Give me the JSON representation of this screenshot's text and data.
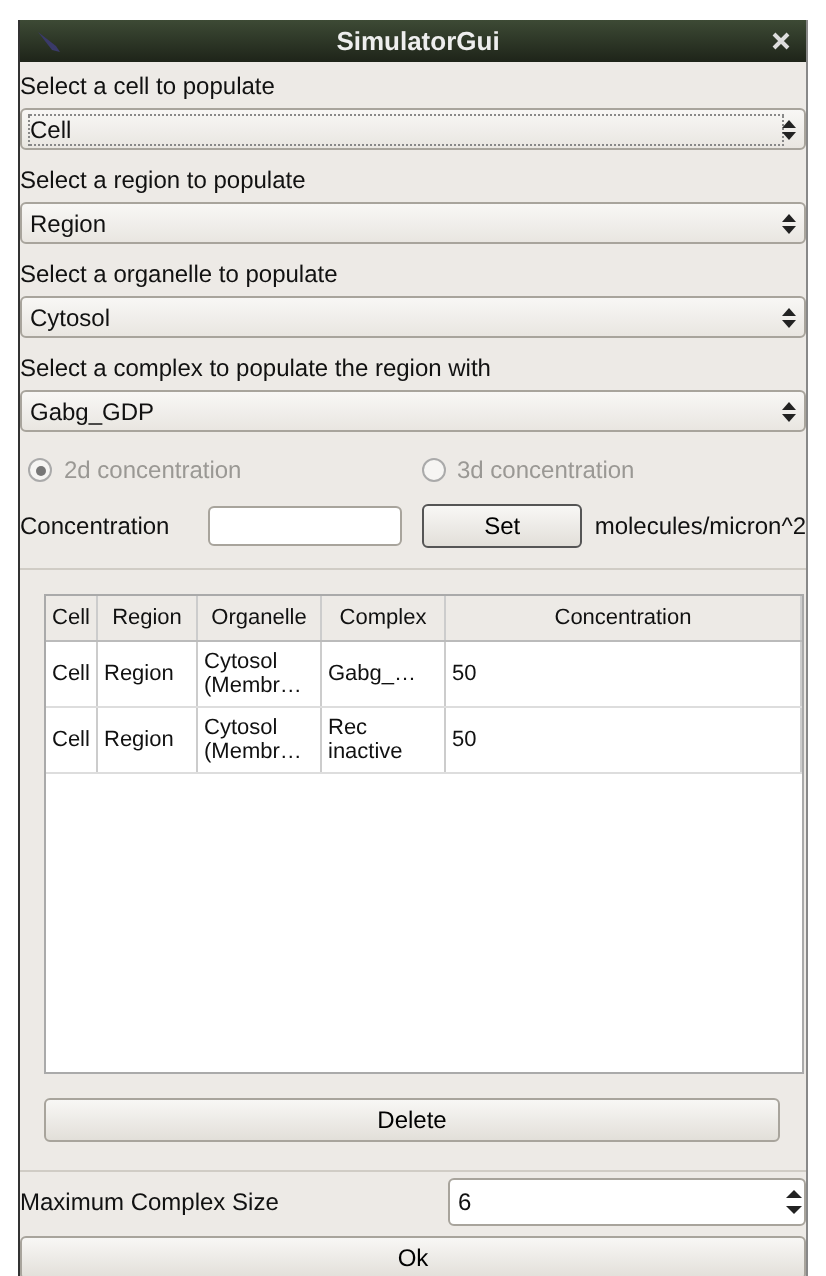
{
  "window": {
    "title": "SimulatorGui"
  },
  "selectors": [
    {
      "label": "Select a cell to populate",
      "value": "Cell",
      "focused": true
    },
    {
      "label": "Select a region to populate",
      "value": "Region",
      "focused": false
    },
    {
      "label": "Select a organelle to populate",
      "value": "Cytosol",
      "focused": false
    },
    {
      "label": "Select a complex to populate the region with",
      "value": "Gabg_GDP",
      "focused": false
    }
  ],
  "radios": [
    {
      "label": "2d concentration",
      "selected": true,
      "disabled": true
    },
    {
      "label": "3d concentration",
      "selected": false,
      "disabled": true
    }
  ],
  "concentration": {
    "label": "Concentration",
    "button": "Set",
    "unit": "molecules/micron^2"
  },
  "table": {
    "columns": [
      "Cell",
      "Region",
      "Organelle",
      "Complex",
      "Concentration"
    ],
    "rows": [
      [
        "Cell",
        "Region",
        "Cytosol (Membr…",
        "Gabg_…",
        "50"
      ],
      [
        "Cell",
        "Region",
        "Cytosol (Membr…",
        "Rec inactive",
        "50"
      ]
    ]
  },
  "delete_button": "Delete",
  "max_complex_size": {
    "label": "Maximum Complex Size",
    "value": "6"
  },
  "ok_button": "Ok"
}
